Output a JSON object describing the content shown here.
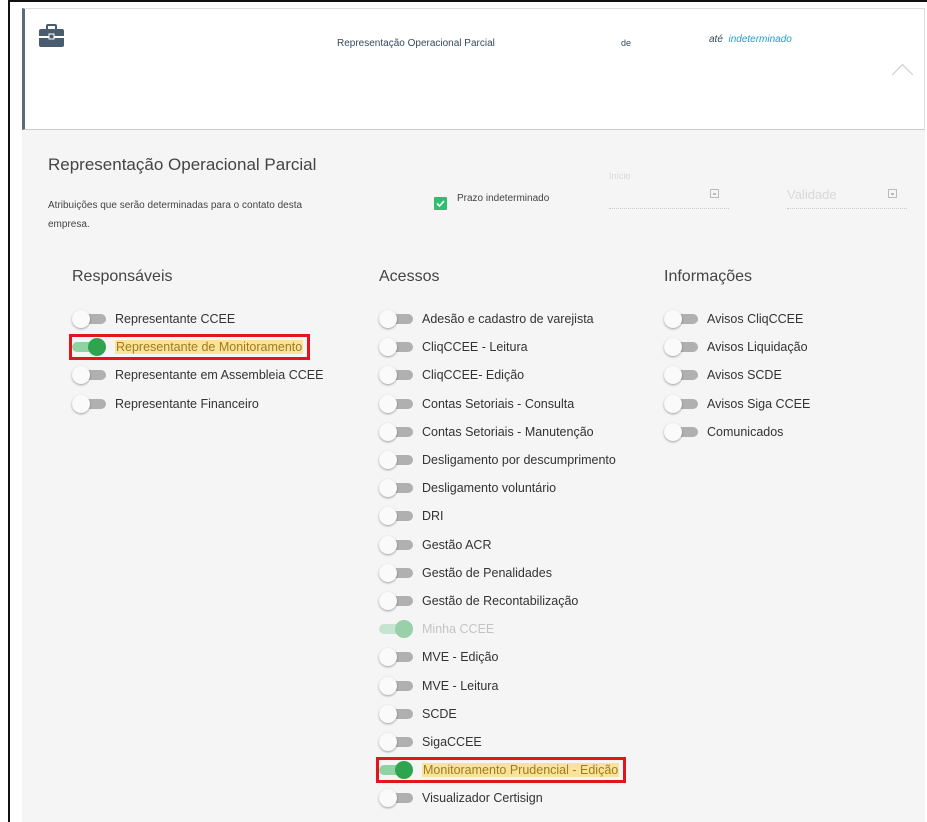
{
  "header": {
    "title": "Representação Operacional Parcial",
    "de_label": "de",
    "ate_label": "até",
    "ate_value": "indeterminado"
  },
  "section": {
    "title": "Representação Operacional Parcial",
    "description": "Atribuições que serão determinadas para o contato desta empresa.",
    "checkbox_label": "Prazo indeterminado",
    "checkbox_checked": true,
    "inicio_label": "Início",
    "validade_label": "Validade"
  },
  "columns": {
    "responsaveis": {
      "title": "Responsáveis",
      "items": [
        {
          "label": "Representante CCEE",
          "on": false
        },
        {
          "label": "Representante de Monitoramento",
          "on": true,
          "highlighted": true
        },
        {
          "label": "Representante em Assembleia CCEE",
          "on": false
        },
        {
          "label": "Representante Financeiro",
          "on": false
        }
      ]
    },
    "acessos": {
      "title": "Acessos",
      "items": [
        {
          "label": "Adesão e cadastro de varejista",
          "on": false
        },
        {
          "label": "CliqCCEE - Leitura",
          "on": false
        },
        {
          "label": "CliqCCEE- Edição",
          "on": false
        },
        {
          "label": "Contas Setoriais - Consulta",
          "on": false
        },
        {
          "label": "Contas Setoriais - Manutenção",
          "on": false
        },
        {
          "label": "Desligamento por descumprimento",
          "on": false
        },
        {
          "label": "Desligamento voluntário",
          "on": false
        },
        {
          "label": "DRI",
          "on": false
        },
        {
          "label": "Gestão ACR",
          "on": false
        },
        {
          "label": "Gestão de Penalidades",
          "on": false
        },
        {
          "label": "Gestão de Recontabilização",
          "on": false
        },
        {
          "label": "Minha CCEE",
          "on": true,
          "disabled": true
        },
        {
          "label": "MVE - Edição",
          "on": false
        },
        {
          "label": "MVE - Leitura",
          "on": false
        },
        {
          "label": "SCDE",
          "on": false
        },
        {
          "label": "SigaCCEE",
          "on": false
        },
        {
          "label": "Monitoramento Prudencial - Edição",
          "on": true,
          "highlighted": true
        },
        {
          "label": "Visualizador Certisign",
          "on": false
        }
      ]
    },
    "informacoes": {
      "title": "Informações",
      "items": [
        {
          "label": "Avisos CliqCCEE",
          "on": false
        },
        {
          "label": "Avisos Liquidação",
          "on": false
        },
        {
          "label": "Avisos SCDE",
          "on": false
        },
        {
          "label": "Avisos Siga CCEE",
          "on": false
        },
        {
          "label": "Comunicados",
          "on": false
        }
      ]
    }
  },
  "colors": {
    "toggle_on": "#2ea44f",
    "highlight": "#f7e49a",
    "annotation_box": "#e3141b",
    "checkbox": "#2fbf71",
    "link": "#20a0c8"
  }
}
